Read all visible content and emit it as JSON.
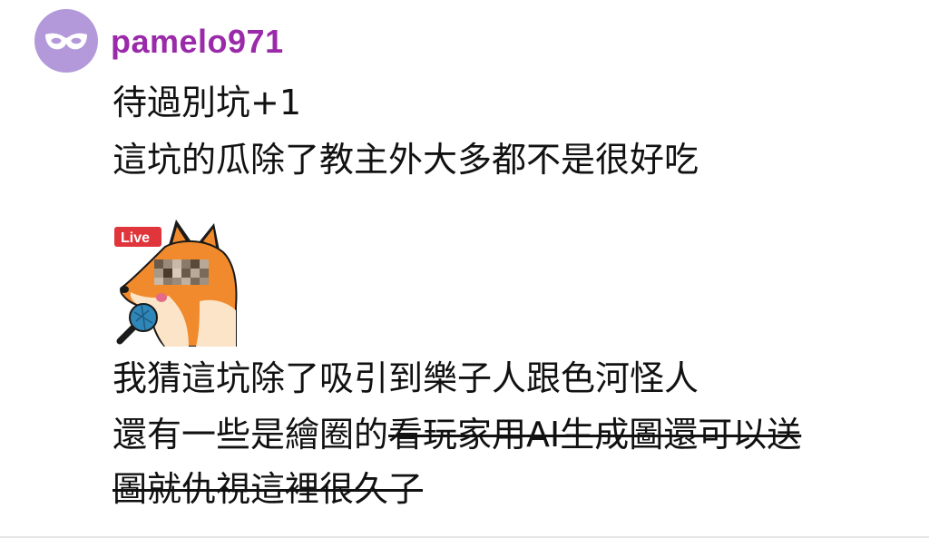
{
  "comment": {
    "author": "pamelo971",
    "lines": [
      {
        "plain": "待過別坑+1",
        "struck": ""
      },
      {
        "plain": "這坑的瓜除了教主外大多都不是很好吃",
        "struck": ""
      },
      {
        "plain": "我猜這坑除了吸引到樂子人跟色河怪人",
        "struck": ""
      },
      {
        "plain": "還有一些是繪圈的",
        "struck": "看玩家用AI生成圖還可以送"
      },
      {
        "plain": "",
        "struck": "圖就仇視這裡很久了"
      }
    ],
    "sticker": {
      "badge": "Live",
      "description_icon": "fox-reporter-sticker"
    }
  },
  "colors": {
    "username": "#9a2aa9",
    "avatar_bg": "#b399d9",
    "text": "#111111",
    "live_badge": "#e0353b"
  },
  "icons": {
    "avatar": "mask-icon"
  }
}
